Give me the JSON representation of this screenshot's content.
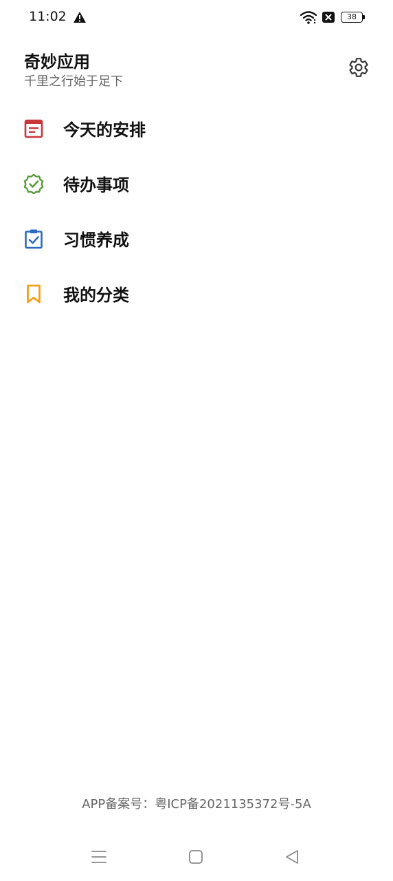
{
  "status_bar": {
    "time": "11:02",
    "battery_level": "38",
    "icons": [
      "warning-icon",
      "wifi-icon",
      "sim-off-icon",
      "battery-icon"
    ]
  },
  "header": {
    "title": "奇妙应用",
    "subtitle": "千里之行始于足下",
    "settings_icon": "gear-icon"
  },
  "menu": {
    "items": [
      {
        "label": "今天的安排",
        "icon": "calendar-note-icon",
        "color": "#c8363a"
      },
      {
        "label": "待办事项",
        "icon": "badge-check-icon",
        "color": "#5a9a3a"
      },
      {
        "label": "习惯养成",
        "icon": "clipboard-check-icon",
        "color": "#2a6bbf"
      },
      {
        "label": "我的分类",
        "icon": "bookmark-icon",
        "color": "#f0a21c"
      }
    ]
  },
  "footer": {
    "icp": "APP备案号：粤ICP备2021135372号-5A"
  },
  "nav_bar": {
    "buttons": [
      "menu-icon",
      "home-icon",
      "back-icon"
    ]
  }
}
